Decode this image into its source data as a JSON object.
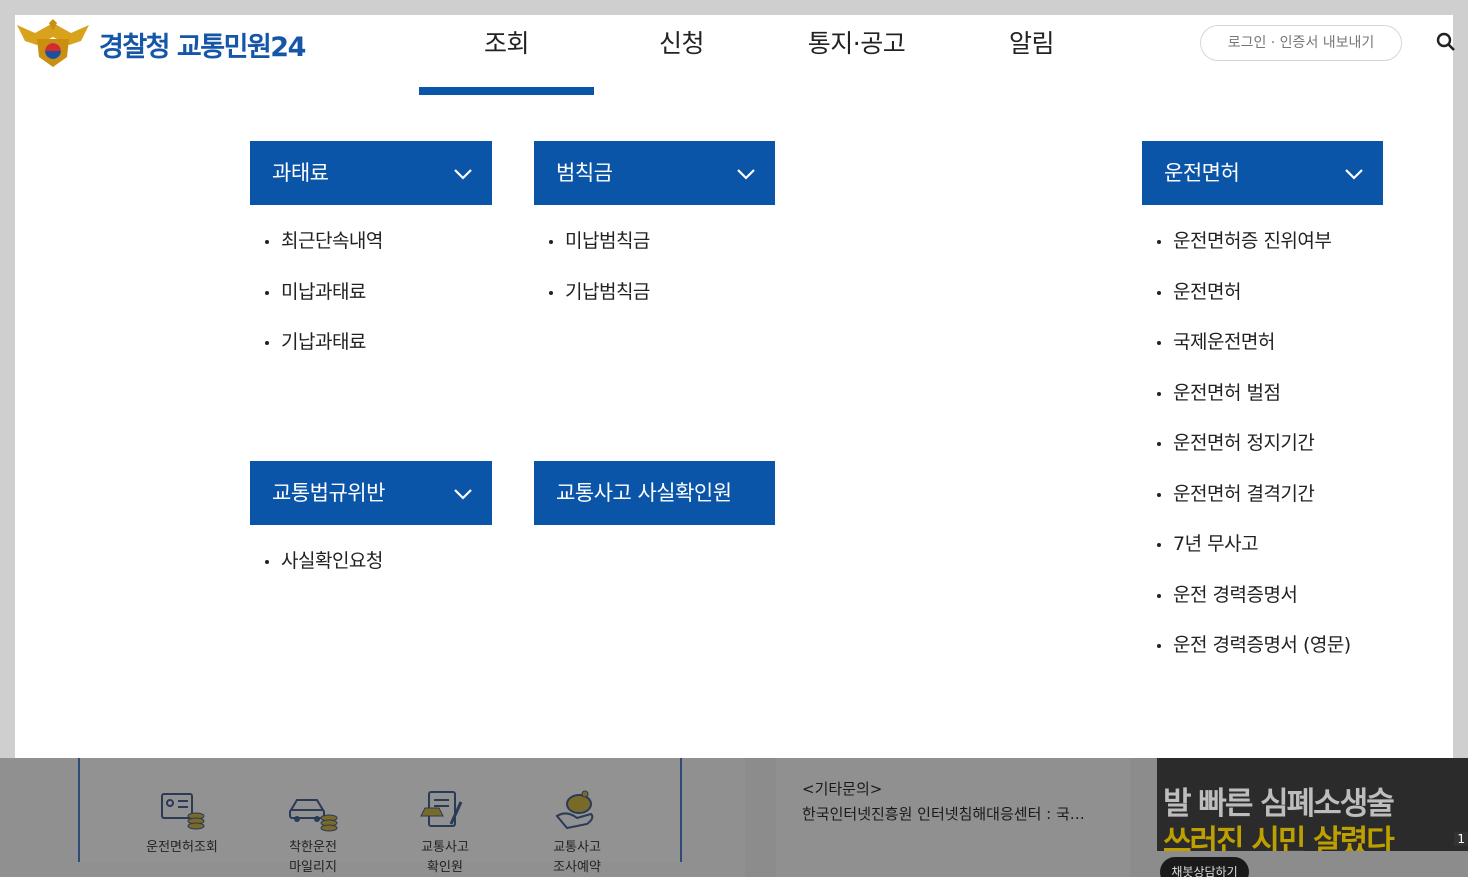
{
  "header": {
    "logo_text": "경찰청 교통민원24",
    "login_label": "로그인 · 인증서 내보내기",
    "nav": [
      "조회",
      "신청",
      "통지·공고",
      "알림"
    ],
    "active_nav": "조회"
  },
  "menus": {
    "fine": {
      "title": "과태료",
      "items": [
        "최근단속내역",
        "미납과태료",
        "기납과태료"
      ]
    },
    "penalty": {
      "title": "범칙금",
      "items": [
        "미납범칙금",
        "기납범칙금"
      ]
    },
    "license": {
      "title": "운전면허",
      "items": [
        "운전면허증 진위여부",
        "운전면허",
        "국제운전면허",
        "운전면허 벌점",
        "운전면허 정지기간",
        "운전면허 결격기간",
        "7년 무사고",
        "운전 경력증명서",
        "운전 경력증명서 (영문)"
      ]
    },
    "violation": {
      "title": "교통법규위반",
      "items": [
        "사실확인요청"
      ]
    },
    "accident": {
      "title": "교통사고 사실확인원"
    }
  },
  "background": {
    "quick_links": [
      {
        "line1": "운전면허조회",
        "line2": ""
      },
      {
        "line1": "착한운전",
        "line2": "마일리지"
      },
      {
        "line1": "교통사고",
        "line2": "확인원"
      },
      {
        "line1": "교통사고",
        "line2": "조사예약"
      }
    ],
    "news_category": "<기타문의>",
    "news_title": "한국인터넷진흥원 인터넷침해대응센터 : 국…",
    "banner_line1": "발 빠른 심폐소생술",
    "banner_line2": "쓰러진 시민 살렸다",
    "banner_page": "1",
    "consult_label": "채봇상담하기"
  },
  "colors": {
    "brand_blue": "#0b55a8",
    "logo_blue": "#1556a8"
  }
}
